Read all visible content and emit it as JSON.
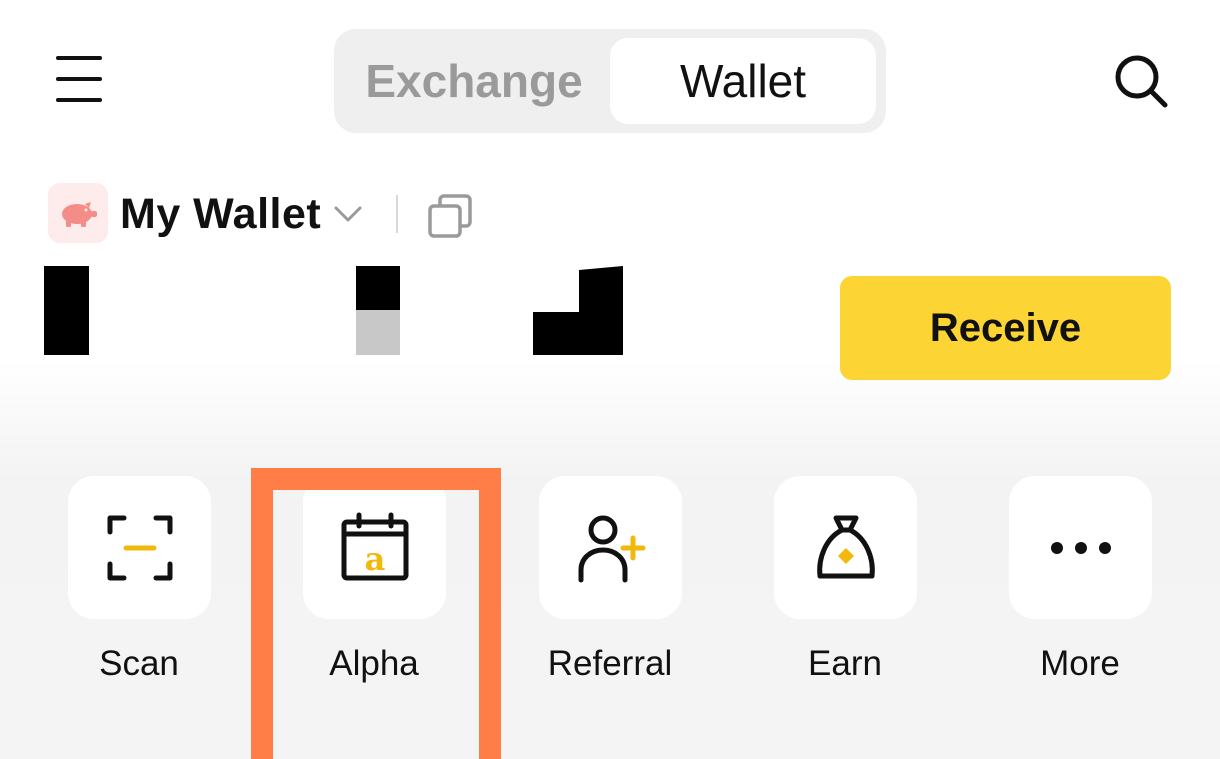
{
  "header": {
    "menu_icon": "hamburger-menu-icon",
    "tabs": [
      {
        "label": "Exchange",
        "active": false
      },
      {
        "label": "Wallet",
        "active": true
      }
    ],
    "search_icon": "search-icon"
  },
  "wallet": {
    "avatar_icon": "piggy-bank-icon",
    "name": "My Wallet",
    "dropdown_icon": "chevron-down-icon",
    "copy_icon": "copy-icon"
  },
  "receive": {
    "label": "Receive"
  },
  "shortcuts": [
    {
      "label": "Scan",
      "icon": "scan-icon"
    },
    {
      "label": "Alpha",
      "icon": "alpha-calendar-icon"
    },
    {
      "label": "Referral",
      "icon": "add-user-icon"
    },
    {
      "label": "Earn",
      "icon": "money-bag-icon"
    },
    {
      "label": "More",
      "icon": "more-dots-icon"
    }
  ],
  "colors": {
    "accent": "#fcd535",
    "highlight": "#ff7d47",
    "avatar_bg": "#fdeceb",
    "avatar_fg": "#f48d88"
  }
}
